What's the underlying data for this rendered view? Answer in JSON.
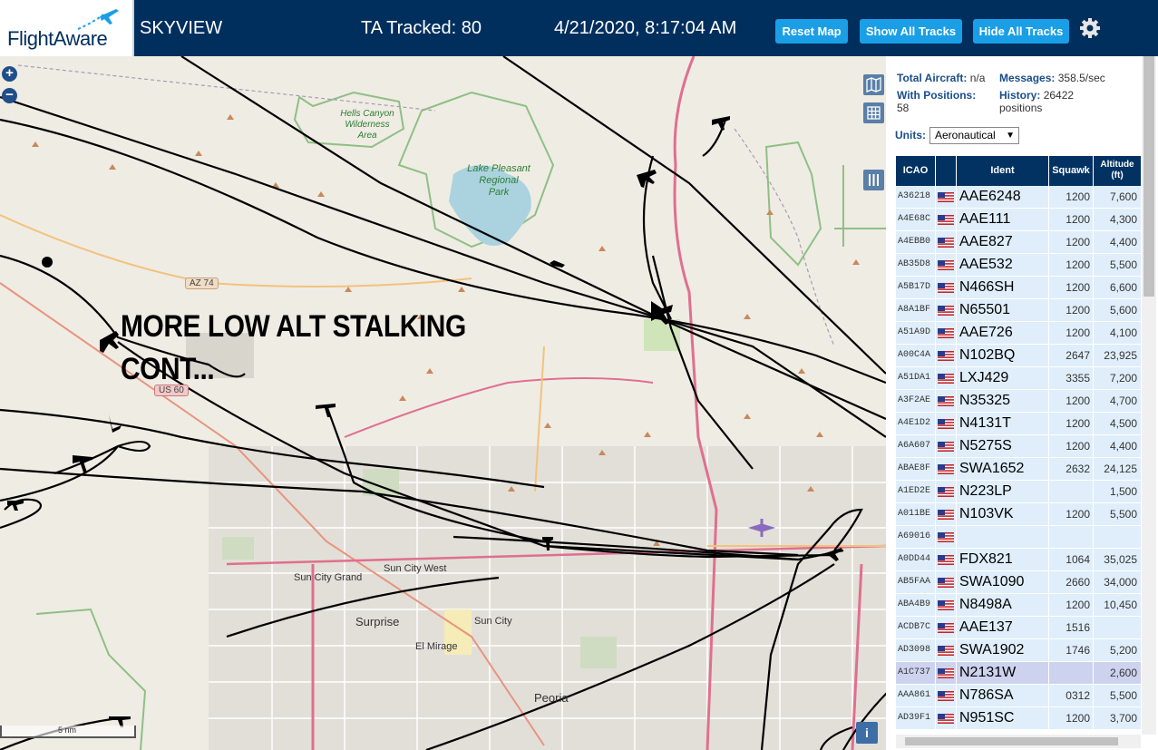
{
  "header": {
    "logo_text": "FlightAware",
    "app_title": "SKYVIEW",
    "tracked": "TA Tracked: 80",
    "clock": "4/21/2020, 8:17:04 AM",
    "reset_label": "Reset Map",
    "show_label": "Show All Tracks",
    "hide_label": "Hide All Tracks"
  },
  "map": {
    "overlay_line1": "MORE LOW ALT STALKING",
    "overlay_line2": "CONT...",
    "scale": "5 nm",
    "labels": {
      "hells_canyon": "Hells Canyon",
      "wilderness": "Wilderness",
      "area": "Area",
      "lake_pleasant": "Lake Pleasant",
      "regional": "Regional",
      "park": "Park",
      "az74": "AZ 74",
      "us60": "US 60",
      "sun_city_grand": "Sun City Grand",
      "sun_city_west": "Sun City West",
      "surprise": "Surprise",
      "sun_city": "Sun City",
      "el_mirage": "El Mirage",
      "peoria": "Peoria"
    },
    "info_label": "i"
  },
  "stats": {
    "total_label": "Total Aircraft:",
    "total_value": "n/a",
    "messages_label": "Messages:",
    "messages_value": "358.5/sec",
    "positions_label": "With Positions:",
    "positions_value": "58",
    "history_label": "History:",
    "history_value": "26422",
    "history_unit": "positions",
    "units_label": "Units:",
    "units_value": "Aeronautical"
  },
  "table": {
    "headers": [
      "ICAO",
      "",
      "Ident",
      "Squawk",
      "Altitude (ft)"
    ],
    "rows": [
      {
        "icao": "A36218",
        "ident": "AAE6248",
        "squawk": "1200",
        "alt": "7,600"
      },
      {
        "icao": "A4E68C",
        "ident": "AAE111",
        "squawk": "1200",
        "alt": "4,300"
      },
      {
        "icao": "A4EBB0",
        "ident": "AAE827",
        "squawk": "1200",
        "alt": "4,400"
      },
      {
        "icao": "AB35D8",
        "ident": "AAE532",
        "squawk": "1200",
        "alt": "5,500"
      },
      {
        "icao": "A5B17D",
        "ident": "N466SH",
        "squawk": "1200",
        "alt": "6,600"
      },
      {
        "icao": "A8A1BF",
        "ident": "N65501",
        "squawk": "1200",
        "alt": "5,600"
      },
      {
        "icao": "A51A9D",
        "ident": "AAE726",
        "squawk": "1200",
        "alt": "4,100"
      },
      {
        "icao": "A00C4A",
        "ident": "N102BQ",
        "squawk": "2647",
        "alt": "23,925"
      },
      {
        "icao": "A51DA1",
        "ident": "LXJ429",
        "squawk": "3355",
        "alt": "7,200"
      },
      {
        "icao": "A3F2AE",
        "ident": "N35325",
        "squawk": "1200",
        "alt": "4,700"
      },
      {
        "icao": "A4E1D2",
        "ident": "N4131T",
        "squawk": "1200",
        "alt": "4,500"
      },
      {
        "icao": "A6A607",
        "ident": "N5275S",
        "squawk": "1200",
        "alt": "4,400"
      },
      {
        "icao": "ABAE8F",
        "ident": "SWA1652",
        "squawk": "2632",
        "alt": "24,125"
      },
      {
        "icao": "A1ED2E",
        "ident": "N223LP",
        "squawk": "",
        "alt": "1,500"
      },
      {
        "icao": "A011BE",
        "ident": "N103VK",
        "squawk": "1200",
        "alt": "5,500"
      },
      {
        "icao": "A69016",
        "ident": "",
        "squawk": "",
        "alt": ""
      },
      {
        "icao": "A0DD44",
        "ident": "FDX821",
        "squawk": "1064",
        "alt": "35,025"
      },
      {
        "icao": "AB5FAA",
        "ident": "SWA1090",
        "squawk": "2660",
        "alt": "34,000"
      },
      {
        "icao": "ABA4B9",
        "ident": "N8498A",
        "squawk": "1200",
        "alt": "10,450"
      },
      {
        "icao": "ACDB7C",
        "ident": "AAE137",
        "squawk": "1516",
        "alt": ""
      },
      {
        "icao": "AD3098",
        "ident": "SWA1902",
        "squawk": "1746",
        "alt": "5,200"
      },
      {
        "icao": "A1C737",
        "ident": "N2131W",
        "squawk": "",
        "alt": "2,600"
      },
      {
        "icao": "AAA861",
        "ident": "N786SA",
        "squawk": "0312",
        "alt": "5,500"
      },
      {
        "icao": "AD39F1",
        "ident": "N951SC",
        "squawk": "1200",
        "alt": "3,700"
      }
    ],
    "selected_index": 21
  },
  "colors": {
    "header_bg": "#002f5d",
    "button_bg": "#1a9fe6",
    "table_head": "#013262",
    "row_bg": "#dfeefa",
    "row_selected": "#cdd3ef"
  }
}
